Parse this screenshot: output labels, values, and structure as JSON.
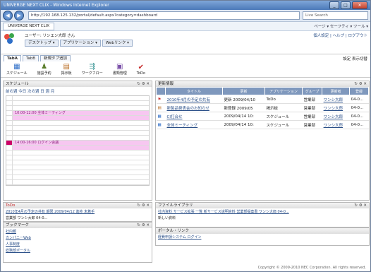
{
  "browser": {
    "title": "UNIVERGE NEXT CLIX - Windows Internet Explorer",
    "address": "http://192.168.125.132/portal/default.aspx?category=dashboard",
    "search_placeholder": "Live Search",
    "fav_tab": "UNIVERGE NEXT CLIX",
    "tools": "ページ ▾  セーフティ ▾  ツール ▾",
    "btn_min": "_",
    "btn_max": "□",
    "btn_close": "✕",
    "nav_back": "◀",
    "nav_fwd": "▶"
  },
  "app": {
    "user": "ユーザー: リンエン大郎 さん",
    "menus": [
      "デスクトップ ▾",
      "アプリケーション ▾",
      "Webリンク ▾"
    ],
    "toplinks": "個人設定 | ヘルプ | ログアウト",
    "tabs": [
      "TabA",
      "TabB",
      "新規タブ追加"
    ],
    "tabs_right": "設定  表示切替",
    "apps": [
      {
        "icon": "calendar-icon",
        "glyph": "▦",
        "label": "スケジュール"
      },
      {
        "icon": "people-icon",
        "glyph": "♟",
        "label": "施設予約"
      },
      {
        "icon": "board-icon",
        "glyph": "▤",
        "label": "掲示板"
      },
      {
        "icon": "workflow-icon",
        "glyph": "⇶",
        "label": "ワークフロー"
      },
      {
        "icon": "folder-icon",
        "glyph": "▣",
        "label": "書類管理"
      },
      {
        "icon": "todo-icon",
        "glyph": "✔",
        "label": "ToDo"
      }
    ]
  },
  "schedule": {
    "title": "スケジュール",
    "nav": "前の週  今日  次の週    日 週 月",
    "events": [
      "10:00-12:00 全体ミーティング",
      "14:00-16:00 ログイン会議"
    ],
    "tools": "↻ ⚙ ✕"
  },
  "updates": {
    "title": "更新情報",
    "tools": "↻ ⚙ ✕",
    "headers": [
      "",
      "タイトル",
      "更新",
      "アプリケーション",
      "グループ",
      "更新者",
      "登録"
    ],
    "rows": [
      [
        "⚑",
        "2010年4月の予定の共有",
        "更新 2009/04/10",
        "ToDo",
        "営業部",
        "ワンシ大郎",
        "04-0..."
      ],
      [
        "▤",
        "新製品発表会のお知らせ",
        "新登録 2009/05",
        "掲示板",
        "営業部",
        "ワンシ大郎",
        "04-0..."
      ],
      [
        "▦",
        "CI打合せ",
        "2009/04/14 10:",
        "スケジュール",
        "営業部",
        "ワンシ大郎",
        "04-0..."
      ],
      [
        "▦",
        "全体ミーティング",
        "2009/04/14 10:",
        "スケジュール",
        "営業部",
        "ワンシ大郎",
        "04-0..."
      ]
    ]
  },
  "todo": {
    "title": "ToDo",
    "tools": "↻ ⚙ ✕",
    "line1": "2010年4月の予定の共有   期限 2009/04/12   進捗 未着手",
    "line2": "営業部     ワンシ大郎    04-0..."
  },
  "bookmarks": {
    "title": "ブックマーク",
    "tools": "↻ ⚙ ✕",
    "items": [
      "社内報",
      "カンパニーWeb",
      "人事制度",
      "総務部ポータル"
    ]
  },
  "filelib": {
    "title": "ファイルライブラリ",
    "tools": "↻ ⚙ ✕",
    "line": "社内資料 サービス拡張 一覧    新サービス説明資料    営業部提案書    ワンシ大郎    04-0...",
    "sub": "新しい資料"
  },
  "portal": {
    "title": "ポータル・リンク",
    "line": "経費申請システム     ログイン"
  },
  "footer": "Copyright © 2009-2010 NEC Corporation. All rights reserved."
}
